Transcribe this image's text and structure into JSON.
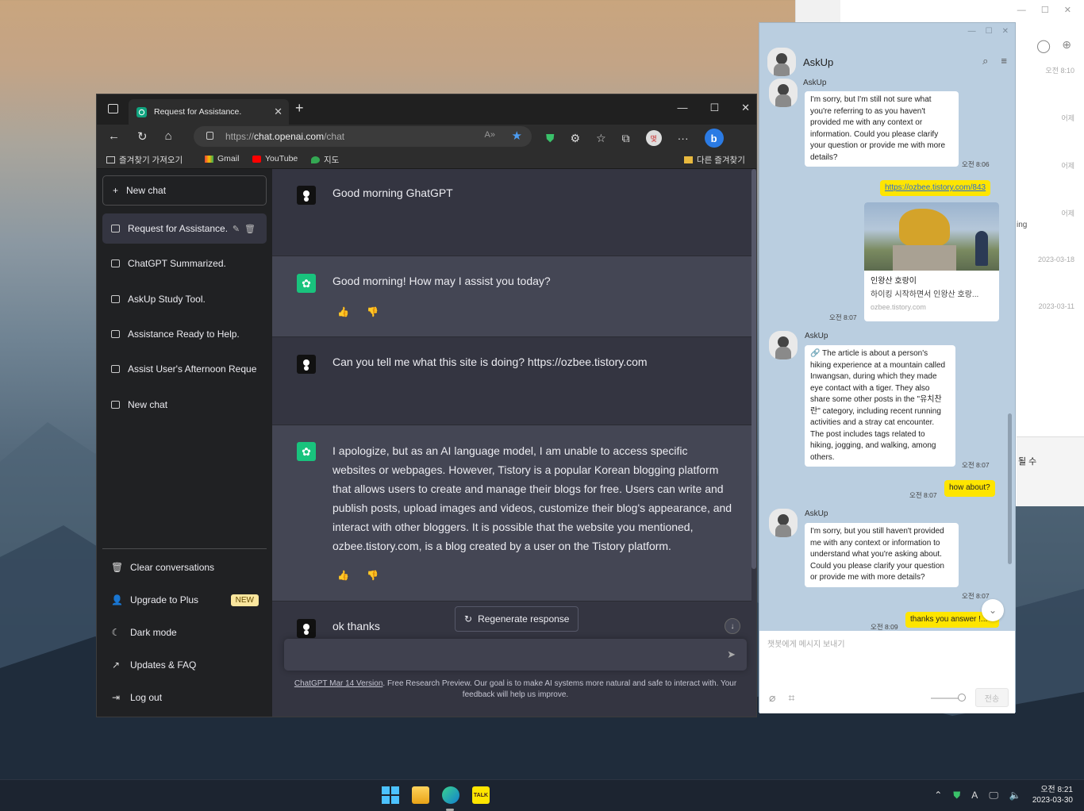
{
  "background_window": {
    "times": [
      "오전 8:10",
      "어제",
      "어제",
      "어제",
      "2023-03-18",
      "2023-03-11"
    ],
    "partial_texts": [
      "ing",
      "될 수"
    ]
  },
  "browser": {
    "tab_title": "Request for Assistance.",
    "url_prefix": "https://",
    "url_host": "chat.openai.com",
    "url_path": "/chat",
    "bookmarks": {
      "import": "즐겨찾기 가져오기",
      "gmail": "Gmail",
      "youtube": "YouTube",
      "maps": "지도",
      "other": "다른 즐겨찾기"
    },
    "profile_initial": "몇"
  },
  "chatgpt": {
    "sidebar": {
      "new_chat": "New chat",
      "history": [
        "Request for Assistance.",
        "ChatGPT Summarized.",
        "AskUp Study Tool.",
        "Assistance Ready to Help.",
        "Assist User's Afternoon Reque",
        "New chat"
      ],
      "footer": {
        "clear": "Clear conversations",
        "upgrade": "Upgrade to Plus",
        "new_badge": "NEW",
        "dark": "Dark mode",
        "updates": "Updates & FAQ",
        "logout": "Log out"
      }
    },
    "messages": [
      {
        "role": "user",
        "text": "Good morning GhatGPT"
      },
      {
        "role": "assistant",
        "text": "Good morning! How may I assist you today?"
      },
      {
        "role": "user",
        "text": "Can you tell me what this site is doing? https://ozbee.tistory.com"
      },
      {
        "role": "assistant",
        "text": "I apologize, but as an AI language model, I am unable to access specific websites or webpages. However, Tistory is a popular Korean blogging platform that allows users to create and manage their blogs for free. Users can write and publish posts, upload images and videos, customize their blog's appearance, and interact with other bloggers. It is possible that the website you mentioned, ozbee.tistory.com, is a blog created by a user on the Tistory platform."
      },
      {
        "role": "user",
        "text": "ok thanks"
      }
    ],
    "regenerate": "Regenerate response",
    "disclaimer_link": "ChatGPT Mar 14 Version",
    "disclaimer_text": ". Free Research Preview. Our goal is to make AI systems more natural and safe to interact with. Your feedback will help us improve."
  },
  "kakao": {
    "title": "AskUp",
    "partial_name": "AskUp",
    "msg1": "I'm sorry, but I'm still not sure what you're referring to as you haven't provided me with any context or information. Could you please clarify your question or provide me with more details?",
    "msg1_time": "오전 8:06",
    "link_url": "https://ozbee.tistory.com/843",
    "link_title": "인왕산 호랑이",
    "link_desc": "하이킹 시작하면서 인왕산 호랑...",
    "link_domain": "ozbee.tistory.com",
    "link_time": "오전 8:07",
    "name2": "AskUp",
    "msg2": "🔗 The article is about a person's hiking experience at a mountain called Inwangsan, during which they made eye contact with a tiger. They also share some other posts in the \"유치찬란\" category, including recent running activities and a stray cat encounter. The post includes tags related to hiking, jogging, and walking, among others.",
    "msg2_time": "오전 8:07",
    "me2": "how about?",
    "me2_time": "오전 8:07",
    "name3": "AskUp",
    "msg3": "I'm sorry, but you still haven't provided me with any context or information to understand what you're asking about. Could you please clarify your question or provide me with more details?",
    "msg3_time": "오전 8:07",
    "me3": "thanks you answer !...",
    "me3_time": "오전 8:09",
    "placeholder": "챗봇에게 메시지 보내기",
    "send": "전송"
  },
  "taskbar": {
    "time": "오전 8:21",
    "date": "2023-03-30",
    "ime": "A",
    "kakao_label": "TALK"
  },
  "colors": {
    "chatgpt_green": "#19c37d",
    "kakao_yellow": "#fee500",
    "kakao_bg": "#bacee0"
  }
}
